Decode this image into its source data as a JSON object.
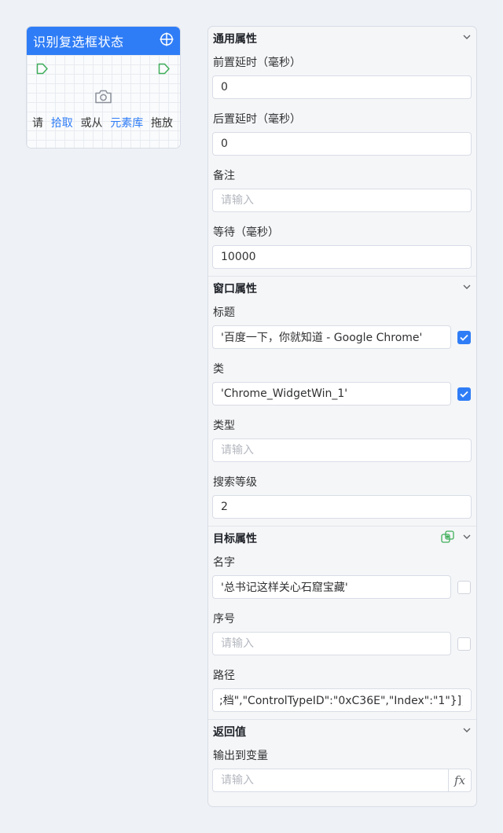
{
  "node": {
    "title": "识别复选框状态",
    "hint_please": "请",
    "hint_pick": "拾取",
    "hint_or_from": "或从",
    "hint_library": "元素库",
    "hint_drag": "拖放",
    "icons": [
      "crosshair-icon",
      "port-in-icon",
      "port-out-icon",
      "camera-icon"
    ]
  },
  "panel": {
    "general": {
      "title": "通用属性",
      "pre_delay_label": "前置延时（毫秒）",
      "pre_delay_value": "0",
      "post_delay_label": "后置延时（毫秒）",
      "post_delay_value": "0",
      "note_label": "备注",
      "note_placeholder": "请输入",
      "wait_label": "等待（毫秒）",
      "wait_value": "10000"
    },
    "window": {
      "title": "窗口属性",
      "title_label": "标题",
      "title_value": "'百度一下，你就知道 - Google Chrome'",
      "title_checked": true,
      "class_label": "类",
      "class_value": "'Chrome_WidgetWin_1'",
      "class_checked": true,
      "type_label": "类型",
      "type_placeholder": "请输入",
      "search_level_label": "搜索等级",
      "search_level_value": "2"
    },
    "target": {
      "title": "目标属性",
      "name_label": "名字",
      "name_value": "'总书记这样关心石窟宝藏'",
      "name_checked": false,
      "index_label": "序号",
      "index_placeholder": "请输入",
      "index_checked": false,
      "path_label": "路径",
      "path_value": ";档\",\"ControlTypeID\":\"0xC36E\",\"Index\":\"1\"}]}"
    },
    "return": {
      "title": "返回值",
      "output_label": "输出到变量",
      "output_placeholder": "请输入",
      "fx_label": "fx"
    }
  },
  "colors": {
    "accent": "#2f7df6",
    "port_green": "#3fae5a",
    "background": "#eef1f6"
  }
}
